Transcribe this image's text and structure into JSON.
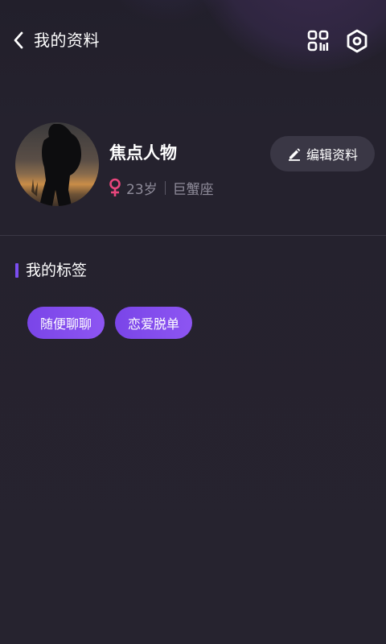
{
  "header": {
    "title": "我的资料",
    "back_icon": "chevron-left-icon",
    "qr_icon": "qr-code-icon",
    "settings_icon": "hexagon-settings-icon"
  },
  "profile": {
    "nickname": "焦点人物",
    "gender": "female",
    "gender_icon": "female-icon",
    "gender_color": "#e8467c",
    "age": "23岁",
    "zodiac": "巨蟹座",
    "edit_label": "编辑资料",
    "edit_icon": "pencil-icon"
  },
  "tags_section": {
    "title": "我的标签",
    "accent": "#7b4ef0",
    "tags": [
      "随便聊聊",
      "恋爱脱单"
    ]
  },
  "colors": {
    "background": "#26232f",
    "button_bg": "#3a3745",
    "secondary_text": "#8f8c9a"
  }
}
